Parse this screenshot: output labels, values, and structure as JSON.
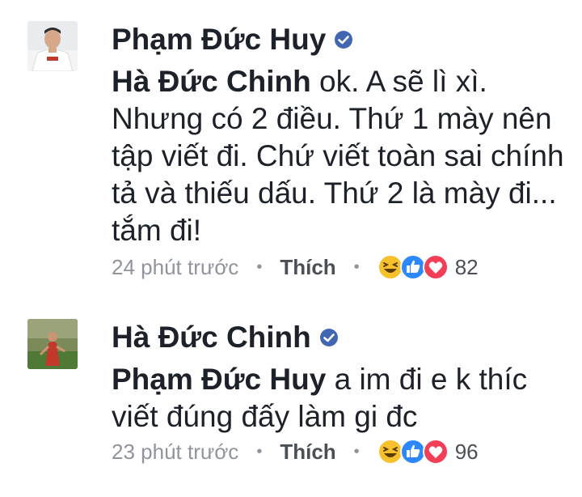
{
  "comments": [
    {
      "author": "Phạm Đức Huy",
      "mention": "Hà Đức Chinh",
      "lines": [
        "ok. A sẽ lì xì.",
        "Nhưng có 2 điều. Thứ 1 mày nên",
        "tập viết đi. Chứ viết toàn sai chính",
        "tả và thiếu dấu. Thứ 2 là mày đi...",
        "tắm đi!"
      ],
      "time": "24 phút trước",
      "like_label": "Thích",
      "reaction_count": "82",
      "reactions": [
        "haha-icon",
        "like-icon",
        "love-icon"
      ]
    },
    {
      "author": "Hà Đức Chinh",
      "mention": "Phạm Đức Huy",
      "lines": [
        "a im đi e k thíc",
        "viết đúng đấy làm gi đc"
      ],
      "time": "23 phút trước",
      "like_label": "Thích",
      "reaction_count": "96",
      "reactions": [
        "haha-icon",
        "like-icon",
        "love-icon"
      ]
    }
  ],
  "colors": {
    "verified": "#4267b2",
    "like": "#2d88ff",
    "love": "#f33e58",
    "haha": "#f7c12e",
    "meta_text": "#90949c"
  }
}
